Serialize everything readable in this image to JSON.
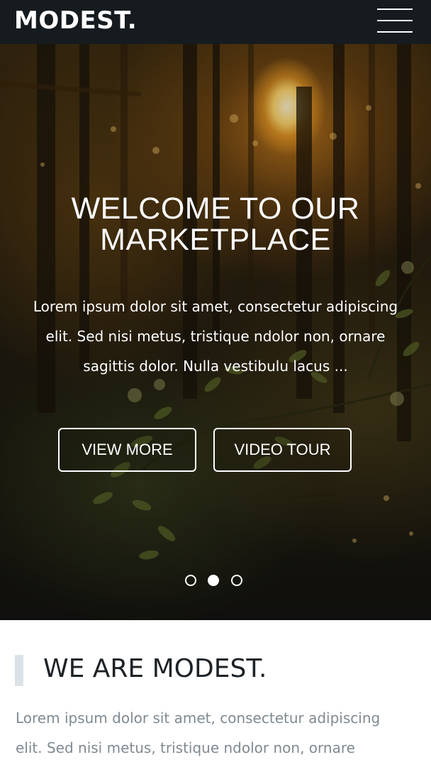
{
  "navbar": {
    "logo": "MODEST.",
    "menu_icon": "hamburger-menu-icon"
  },
  "hero": {
    "title_line1": "WELCOME TO OUR",
    "title_line2": "MARKETPLACE",
    "text_line1": "Lorem ipsum dolor sit amet, consectetur adipiscing",
    "text_line2": "elit. Sed nisi metus, tristique ndolor non, ornare",
    "text_line3": "sagittis dolor. Nulla vestibulu lacus ...",
    "view_more_label": "VIEW MORE",
    "video_tour_label": "VIDEO TOUR",
    "slider": {
      "count": 3,
      "active_index": 1
    }
  },
  "about": {
    "title": "WE ARE MODEST.",
    "text_line1": "Lorem ipsum dolor sit amet, consectetur adipiscing",
    "text_line2": "elit. Sed nisi metus, tristique ndolor non, ornare"
  },
  "colors": {
    "navbar_bg": "#161b1f",
    "accent_bar": "#dce3e8",
    "heading_dark": "#1d2226",
    "body_text_gray": "#7f8a91"
  }
}
